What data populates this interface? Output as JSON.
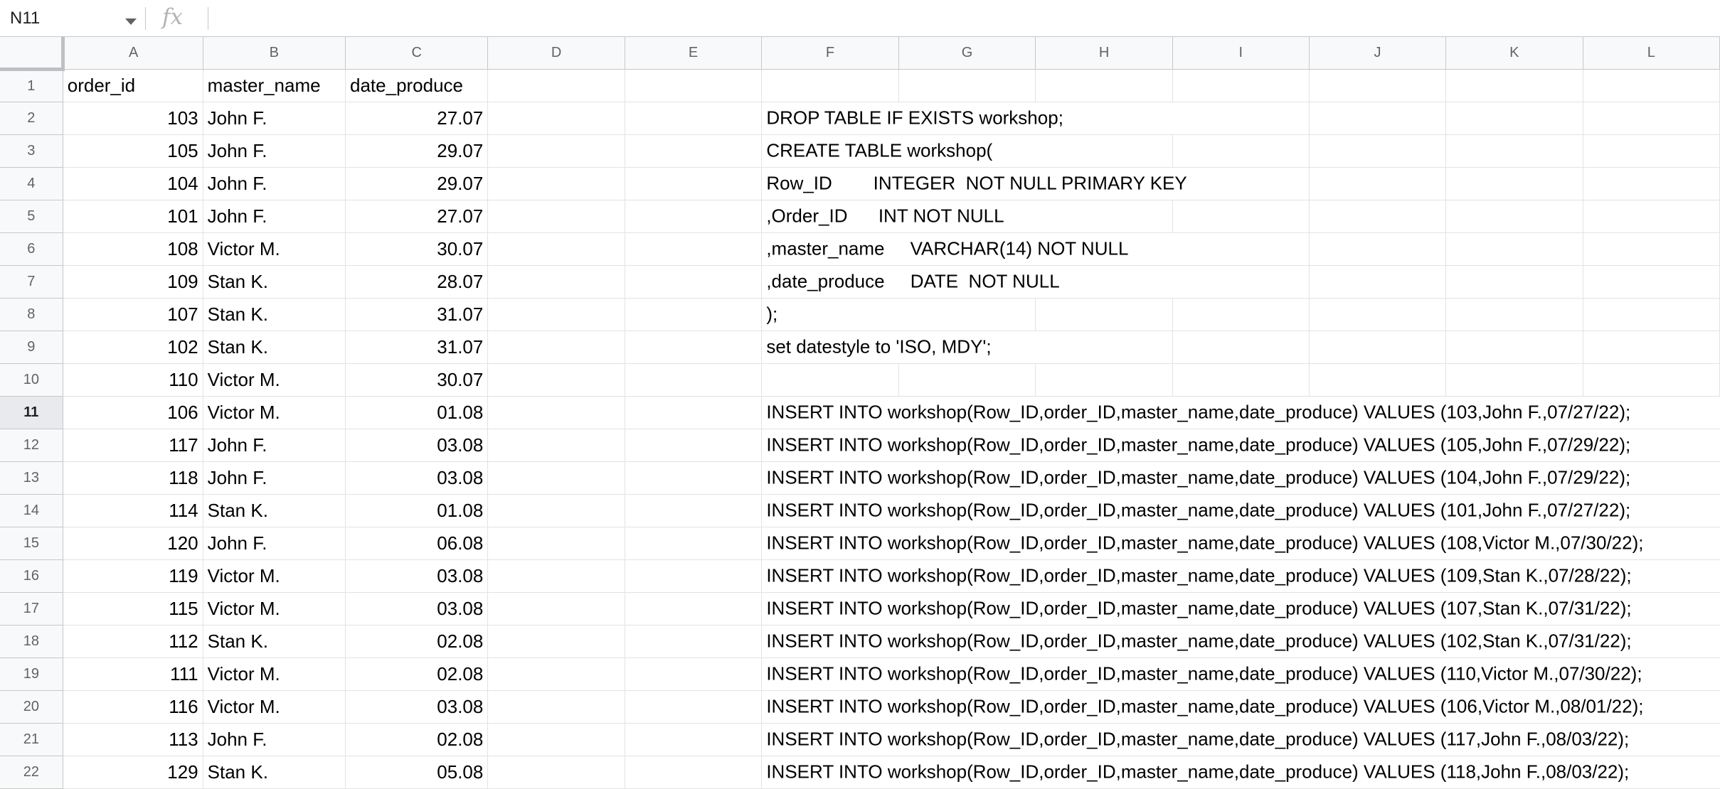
{
  "formula_bar": {
    "cell_ref": "N11",
    "fx_label": "fx",
    "content": ""
  },
  "columns": [
    "A",
    "B",
    "C",
    "D",
    "E",
    "F",
    "G",
    "H",
    "I",
    "J",
    "K",
    "L"
  ],
  "rows": [
    {
      "num": "1",
      "a": "order_id",
      "b": "master_name",
      "c": "date_produce",
      "f": ""
    },
    {
      "num": "2",
      "a": "103",
      "b": "John F.",
      "c": "27.07",
      "f": "DROP TABLE IF EXISTS workshop;"
    },
    {
      "num": "3",
      "a": "105",
      "b": "John F.",
      "c": "29.07",
      "f": "CREATE TABLE workshop("
    },
    {
      "num": "4",
      "a": "104",
      "b": "John F.",
      "c": "29.07",
      "f": "Row_ID        INTEGER  NOT NULL PRIMARY KEY"
    },
    {
      "num": "5",
      "a": "101",
      "b": "John F.",
      "c": "27.07",
      "f": ",Order_ID      INT NOT NULL"
    },
    {
      "num": "6",
      "a": "108",
      "b": "Victor M.",
      "c": "30.07",
      "f": ",master_name     VARCHAR(14) NOT NULL"
    },
    {
      "num": "7",
      "a": "109",
      "b": "Stan K.",
      "c": "28.07",
      "f": ",date_produce     DATE  NOT NULL"
    },
    {
      "num": "8",
      "a": "107",
      "b": "Stan K.",
      "c": "31.07",
      "f": ");"
    },
    {
      "num": "9",
      "a": "102",
      "b": "Stan K.",
      "c": "31.07",
      "f": "set datestyle to 'ISO, MDY';"
    },
    {
      "num": "10",
      "a": "110",
      "b": "Victor M.",
      "c": "30.07",
      "f": ""
    },
    {
      "num": "11",
      "a": "106",
      "b": "Victor M.",
      "c": "01.08",
      "f": "INSERT INTO workshop(Row_ID,order_ID,master_name,date_produce) VALUES (103,John F.,07/27/22);"
    },
    {
      "num": "12",
      "a": "117",
      "b": "John F.",
      "c": "03.08",
      "f": "INSERT INTO workshop(Row_ID,order_ID,master_name,date_produce) VALUES (105,John F.,07/29/22);"
    },
    {
      "num": "13",
      "a": "118",
      "b": "John F.",
      "c": "03.08",
      "f": "INSERT INTO workshop(Row_ID,order_ID,master_name,date_produce) VALUES (104,John F.,07/29/22);"
    },
    {
      "num": "14",
      "a": "114",
      "b": "Stan K.",
      "c": "01.08",
      "f": "INSERT INTO workshop(Row_ID,order_ID,master_name,date_produce) VALUES (101,John F.,07/27/22);"
    },
    {
      "num": "15",
      "a": "120",
      "b": "John F.",
      "c": "06.08",
      "f": "INSERT INTO workshop(Row_ID,order_ID,master_name,date_produce) VALUES (108,Victor M.,07/30/22);"
    },
    {
      "num": "16",
      "a": "119",
      "b": "Victor M.",
      "c": "03.08",
      "f": "INSERT INTO workshop(Row_ID,order_ID,master_name,date_produce) VALUES (109,Stan K.,07/28/22);"
    },
    {
      "num": "17",
      "a": "115",
      "b": "Victor M.",
      "c": "03.08",
      "f": "INSERT INTO workshop(Row_ID,order_ID,master_name,date_produce) VALUES (107,Stan K.,07/31/22);"
    },
    {
      "num": "18",
      "a": "112",
      "b": "Stan K.",
      "c": "02.08",
      "f": "INSERT INTO workshop(Row_ID,order_ID,master_name,date_produce) VALUES (102,Stan K.,07/31/22);"
    },
    {
      "num": "19",
      "a": "111",
      "b": "Victor M.",
      "c": "02.08",
      "f": "INSERT INTO workshop(Row_ID,order_ID,master_name,date_produce) VALUES (110,Victor M.,07/30/22);"
    },
    {
      "num": "20",
      "a": "116",
      "b": "Victor M.",
      "c": "03.08",
      "f": "INSERT INTO workshop(Row_ID,order_ID,master_name,date_produce) VALUES (106,Victor M.,08/01/22);"
    },
    {
      "num": "21",
      "a": "113",
      "b": "John F.",
      "c": "02.08",
      "f": "INSERT INTO workshop(Row_ID,order_ID,master_name,date_produce) VALUES (117,John F.,08/03/22);"
    },
    {
      "num": "22",
      "a": "129",
      "b": "Stan K.",
      "c": "05.08",
      "f": "INSERT INTO workshop(Row_ID,order_ID,master_name,date_produce) VALUES (118,John F.,08/03/22);"
    }
  ],
  "active_row": "11"
}
